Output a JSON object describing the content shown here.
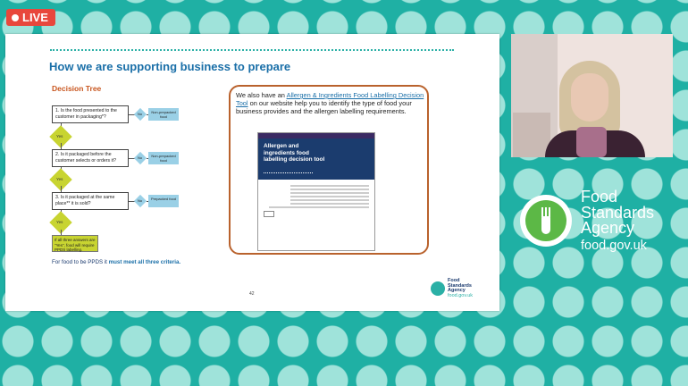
{
  "live_badge": {
    "label": "LIVE"
  },
  "slide": {
    "title": "How we are supporting business to prepare",
    "decision_tree": {
      "heading": "Decision Tree",
      "questions": [
        {
          "text": "1. Is the food presented to the customer in packaging*?",
          "no_label": "No",
          "result": "Non-prepacked food"
        },
        {
          "text": "2. Is it packaged before the customer selects or orders it?",
          "no_label": "No",
          "result": "Non-prepacked food"
        },
        {
          "text": "3. Is it packaged at the same place** it is sold?",
          "no_label": "No",
          "result": "Prepacked food"
        }
      ],
      "yes_label": "Yes",
      "final_box": "If all three answers are \"Yes\", food will require PPDS labelling."
    },
    "criteria_prefix": "For food to be PPDS it",
    "criteria_bold": "must meet all three criteria.",
    "callout": {
      "text_before": "We also have an",
      "link_text": "Allergen & Ingredients Food Labelling Decision Tool",
      "text_after": "on our website help you to identify the type of food your business provides and the allergen labelling requirements."
    },
    "tool_preview": {
      "nav_items": [
        "",
        "",
        "",
        "",
        ""
      ],
      "hero_title": "Allergen and ingredients food labelling decision tool"
    },
    "page_number": "42",
    "logo": {
      "line1": "Food",
      "line2": "Standards",
      "line3": "Agency",
      "url": "food.gov.uk"
    }
  },
  "fsa_brand": {
    "line1": "Food",
    "line2": "Standards",
    "line3": "Agency",
    "url": "food.gov.uk"
  },
  "colors": {
    "background": "#1fb0a4",
    "dots": "#9fe3da",
    "live": "#e8473c",
    "title": "#1a6fa8",
    "accent": "#c8d431",
    "fsa_green": "#5cb846"
  }
}
